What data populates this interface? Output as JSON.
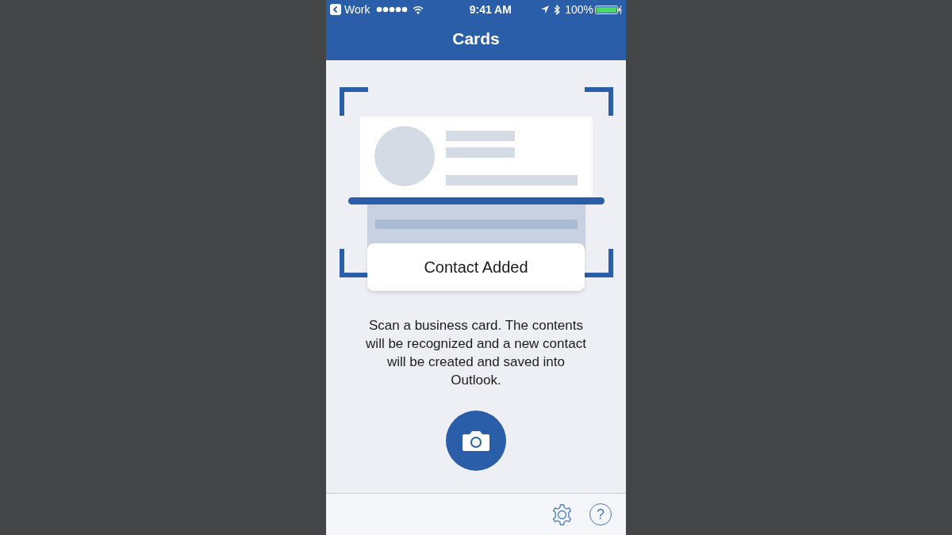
{
  "status_bar": {
    "back_app": "Work",
    "time": "9:41 AM",
    "battery": "100%"
  },
  "nav": {
    "title": "Cards"
  },
  "toast": {
    "text": "Contact Added"
  },
  "instructions": "Scan a business card.  The contents will be recognized and a new contact will be created and saved into Outlook.",
  "toolbar": {
    "help_glyph": "?"
  }
}
